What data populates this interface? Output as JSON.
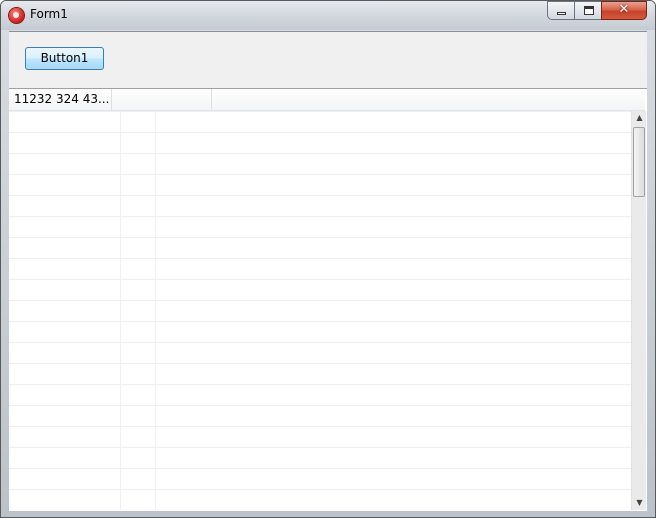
{
  "window": {
    "title": "Form1",
    "icon": "app-icon",
    "controls": {
      "minimize": "minimize-icon",
      "maximize": "maximize-icon",
      "close": "close-icon",
      "close_glyph": "✕"
    }
  },
  "toolbar": {
    "button1_label": "Button1"
  },
  "listview": {
    "columns": [
      {
        "label": "11232 324  43..."
      },
      {
        "label": ""
      },
      {
        "label": ""
      }
    ],
    "rows": []
  },
  "scrollbar": {
    "up": "▲",
    "down": "▼"
  },
  "colors": {
    "close_button": "#c7422b",
    "button_border": "#3c7fb1",
    "client_bg": "#f0f0f0"
  }
}
